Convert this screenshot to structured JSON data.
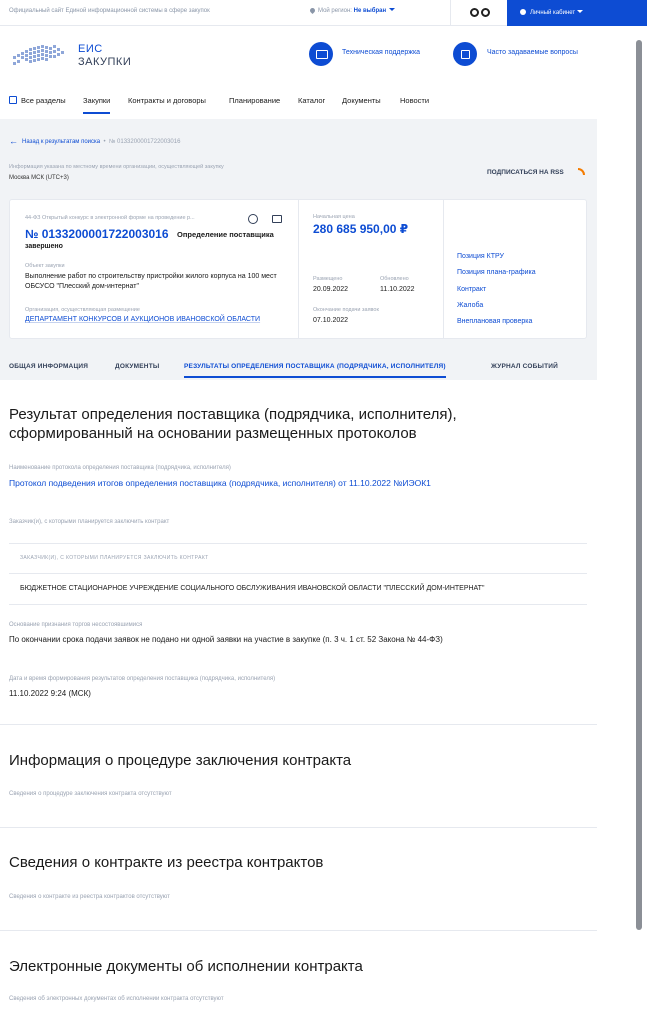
{
  "topbar": {
    "official_site": "Официальный сайт Единой информационной системы в сфере закупок",
    "region_label": "Мой регион:",
    "region_value": "Не выбран",
    "cabinet": "Личный кабинет"
  },
  "header": {
    "logo_line1": "ЕИС",
    "logo_line2": "ЗАКУПКИ",
    "support": "Техническая поддержка",
    "faq": "Часто задаваемые вопросы"
  },
  "nav": {
    "items": [
      "Все разделы",
      "Закупки",
      "Контракты и договоры",
      "Планирование",
      "Каталог",
      "Документы",
      "Новости"
    ]
  },
  "breadcrumb": {
    "back": "Назад к результатам поиска",
    "current": "№ 0133200001722003016"
  },
  "timezone": {
    "note": "Информация указана по местному времени организации, осуществляющей закупку",
    "value": "Москва МСК (UTC+3)"
  },
  "rss": "ПОДПИСАТЬСЯ НА RSS",
  "card": {
    "kind": "44-ФЗ Открытый конкурс в электронной форме на проведение р...",
    "number": "№ 0133200001722003016",
    "stage": "Определение поставщика",
    "status": "завершено",
    "object_label": "Объект закупки",
    "object_value": "Выполнение работ по строительству пристройки жилого корпуса на 100 мест ОБСУСО \"Плесский дом-интернат\"",
    "org_label": "Организация, осуществляющая размещение",
    "org_value": "ДЕПАРТАМЕНТ КОНКУРСОВ И АУКЦИОНОВ ИВАНОВСКОЙ ОБЛАСТИ",
    "price_label": "Начальная цена",
    "price_value": "280 685 950,00 ₽",
    "posted_label": "Размещено",
    "posted_value": "20.09.2022",
    "updated_label": "Обновлено",
    "updated_value": "11.10.2022",
    "deadline_label": "Окончание подачи заявок",
    "deadline_value": "07.10.2022",
    "links": [
      "Позиция КТРУ",
      "Позиция плана-графика",
      "Контракт",
      "Жалоба",
      "Внеплановая проверка"
    ]
  },
  "tabs": [
    "ОБЩАЯ ИНФОРМАЦИЯ",
    "ДОКУМЕНТЫ",
    "РЕЗУЛЬТАТЫ ОПРЕДЕЛЕНИЯ ПОСТАВЩИКА (ПОДРЯДЧИКА, ИСПОЛНИТЕЛЯ)",
    "ЖУРНАЛ СОБЫТИЙ"
  ],
  "result": {
    "title": "Результат определения поставщика (подрядчика, исполнителя), сформированный на основании размещенных протоколов",
    "protocol_label": "Наименование протокола определения поставщика (подрядчика, исполнителя)",
    "protocol_value": "Протокол подведения итогов определения поставщика (подрядчика, исполнителя) от 11.10.2022 №ИЭОК1",
    "customers_label": "Заказчик(и), с которыми планируется заключить контракт",
    "customers_header": "ЗАКАЗЧИК(И), С КОТОРЫМИ ПЛАНИРУЕТСЯ ЗАКЛЮЧИТЬ КОНТРАКТ",
    "customers_row": "БЮДЖЕТНОЕ СТАЦИОНАРНОЕ УЧРЕЖДЕНИЕ СОЦИАЛЬНОГО ОБСЛУЖИВАНИЯ ИВАНОВСКОЙ ОБЛАСТИ \"ПЛЕССКИЙ ДОМ-ИНТЕРНАТ\"",
    "reason_label": "Основание признания торгов несостоявшимися",
    "reason_value": "По окончании срока подачи заявок не подано ни одной заявки на участие в закупке (п. 3 ч. 1 ст. 52 Закона № 44-ФЗ)",
    "datetime_label": "Дата и время формирования результатов определения поставщика (подрядчика, исполнителя)",
    "datetime_value": "11.10.2022 9:24 (МСК)"
  },
  "procedure": {
    "title": "Информация о процедуре заключения контракта",
    "note": "Сведения о процедуре заключения контракта отсутствуют"
  },
  "registry": {
    "title": "Сведения о контракте из реестра контрактов",
    "note": "Сведения о контракте из реестра контрактов отсутствуют"
  },
  "edocs": {
    "title": "Электронные документы об исполнении контракта",
    "note": "Сведения об электронных документах об исполнении контракта отсутствуют"
  },
  "colors": {
    "accent": "#0d4cd3",
    "rss": "#f57c00",
    "muted": "#9aa3b2",
    "panel": "#f1f3f6"
  }
}
